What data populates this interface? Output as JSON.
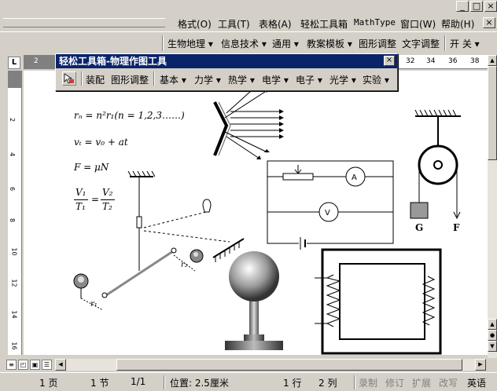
{
  "window": {
    "minimize": "_",
    "restore": "□",
    "close": "×"
  },
  "menubar": {
    "items": [
      "格式(O)",
      "工具(T)",
      "表格(A)",
      "轻松工具箱",
      "MathType",
      "窗口(W)",
      "帮助(H)"
    ],
    "close": "×"
  },
  "toolbar": {
    "items": [
      "生物地理 ▾",
      "信息技术 ▾",
      "通用 ▾",
      "教案模板 ▾",
      "图形调整",
      "文字调整",
      "开 关 ▾"
    ]
  },
  "ruler": {
    "corner": "L",
    "numbers": [
      "2",
      "32",
      "34",
      "36",
      "38"
    ]
  },
  "vruler": {
    "numbers": [
      "2",
      "4",
      "6",
      "8",
      "10",
      "12",
      "14",
      "16"
    ]
  },
  "floating_toolbar": {
    "title": "轻松工具箱-物理作图工具",
    "close": "×",
    "items": [
      "装配",
      "图形调整",
      "基本 ▾",
      "力学 ▾",
      "热学 ▾",
      "电学 ▾",
      "电子 ▾",
      "光学 ▾",
      "实验 ▾"
    ]
  },
  "formulas": {
    "f1": "rₙ = n²r₁(n = 1,2,3……)",
    "f2": "vₜ = v₀ + at",
    "f3": "F = μN",
    "f4a": "V₁",
    "f4b": "T₁",
    "f4c": "V₂",
    "f4d": "T₂"
  },
  "labels": {
    "ammeter": "A",
    "voltmeter": "V",
    "G": "G",
    "F": "F",
    "r1": "r₁",
    "r2": "r₂"
  },
  "status": {
    "page": "1 页",
    "section": "1 节",
    "pages": "1/1",
    "position": "位置: 2.5厘米",
    "line": "1 行",
    "col": "2 列",
    "rec": "录制",
    "trk": "修订",
    "ext": "扩展",
    "ovr": "改写",
    "lang": "英语"
  }
}
